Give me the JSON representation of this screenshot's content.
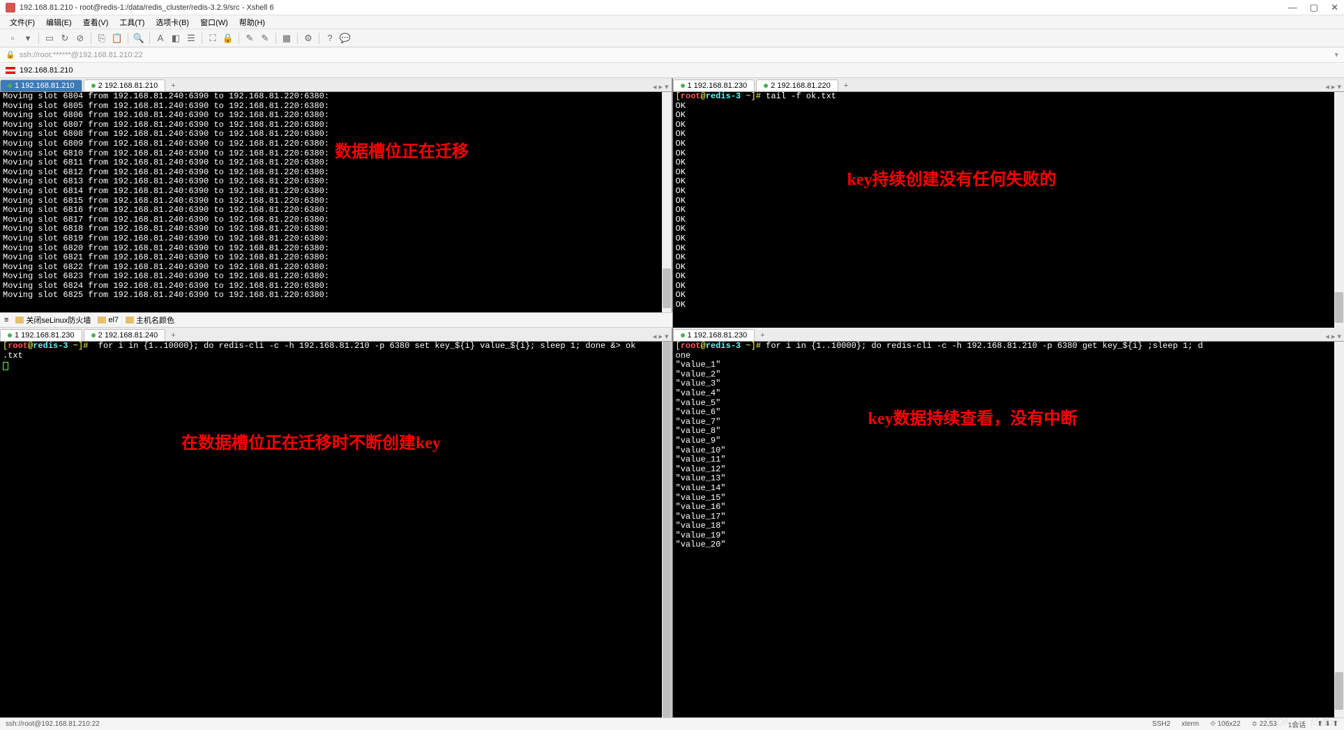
{
  "window": {
    "title": "192.168.81.210 - root@redis-1:/data/redis_cluster/redis-3.2.9/src - Xshell 6",
    "minimize": "—",
    "maximize": "▢",
    "close": "✕"
  },
  "menus": [
    "文件(F)",
    "编辑(E)",
    "查看(V)",
    "工具(T)",
    "选项卡(B)",
    "窗口(W)",
    "帮助(H)"
  ],
  "address_bar": "ssh://root:******@192.168.81.210:22",
  "session_name": "192.168.81.210",
  "quick_items": [
    "关闭seLinux防火墙",
    "el7",
    "主机名颜色"
  ],
  "tabs": {
    "tl": [
      {
        "label": "1 192.168.81.210",
        "active": true
      },
      {
        "label": "2 192.168.81.210",
        "active": false
      }
    ],
    "tr": [
      {
        "label": "1 192.168.81.230",
        "active": false
      },
      {
        "label": "2 192.168.81.220",
        "active": false
      }
    ],
    "bl": [
      {
        "label": "1 192.168.81.230",
        "active": false
      },
      {
        "label": "2 192.168.81.240",
        "active": false
      }
    ],
    "br": [
      {
        "label": "1 192.168.81.230",
        "active": false
      }
    ]
  },
  "term_tl": {
    "slot_start": 6804,
    "slot_end": 6825,
    "from": "192.168.81.240:6390",
    "to": "192.168.81.220:6380",
    "annotation": "数据槽位正在迁移"
  },
  "term_tr": {
    "prompt_user": "root",
    "prompt_host": "redis-3",
    "prompt_path": "~",
    "command": "tail -f ok.txt",
    "ok_count": 22,
    "annotation": "key持续创建没有任何失败的"
  },
  "term_bl": {
    "prompt_user": "root",
    "prompt_host": "redis-3",
    "prompt_path": "~",
    "command": " for i in {1..10000}; do redis-cli -c -h 192.168.81.210 -p 6380 set key_${i} value_${i}; sleep 1; done &> ok.txt",
    "annotation": "在数据槽位正在迁移时不断创建key"
  },
  "term_br": {
    "prompt_user": "root",
    "prompt_host": "redis-3",
    "prompt_path": "~",
    "command_l1": "for i in {1..10000}; do redis-cli -c -h 192.168.81.210 -p 6380 get key_${i} ;sleep 1; d",
    "command_l2": "one",
    "value_start": 1,
    "value_end": 20,
    "annotation": "key数据持续查看，没有中断"
  },
  "status": {
    "left": "ssh://root@192.168.81.210:22",
    "ssh": "SSH2",
    "term": "xterm",
    "size": "106x22",
    "sess": "22,53",
    "sessions": "1会话"
  },
  "watermark": {
    "csdn": "CSDN",
    "yisu": "亿速云"
  }
}
